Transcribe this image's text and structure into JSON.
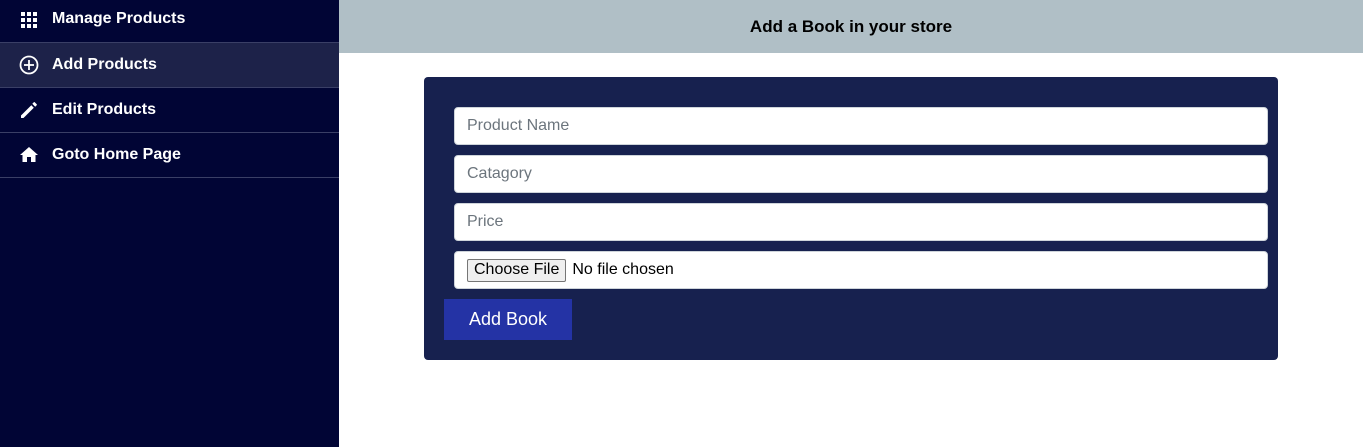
{
  "sidebar": {
    "items": [
      {
        "label": "Manage Products",
        "icon": "grid-icon"
      },
      {
        "label": "Add Products",
        "icon": "plus-circle-icon"
      },
      {
        "label": "Edit Products",
        "icon": "pencil-icon"
      },
      {
        "label": "Goto Home Page",
        "icon": "home-icon"
      }
    ],
    "active_item": "Add Products"
  },
  "header": {
    "title": "Add a Book in your store"
  },
  "form": {
    "product_name": {
      "placeholder": "Product Name",
      "value": ""
    },
    "category": {
      "placeholder": "Catagory",
      "value": ""
    },
    "price": {
      "placeholder": "Price",
      "value": ""
    },
    "file": {
      "button_label": "Choose File",
      "status": "No file chosen"
    },
    "submit_label": "Add Book"
  },
  "colors": {
    "sidebar_bg": "#010535",
    "sidebar_active": "#1d2249",
    "topbar_bg": "#b0bfc6",
    "card_bg": "#17214f",
    "button_bg": "#2433a5"
  }
}
